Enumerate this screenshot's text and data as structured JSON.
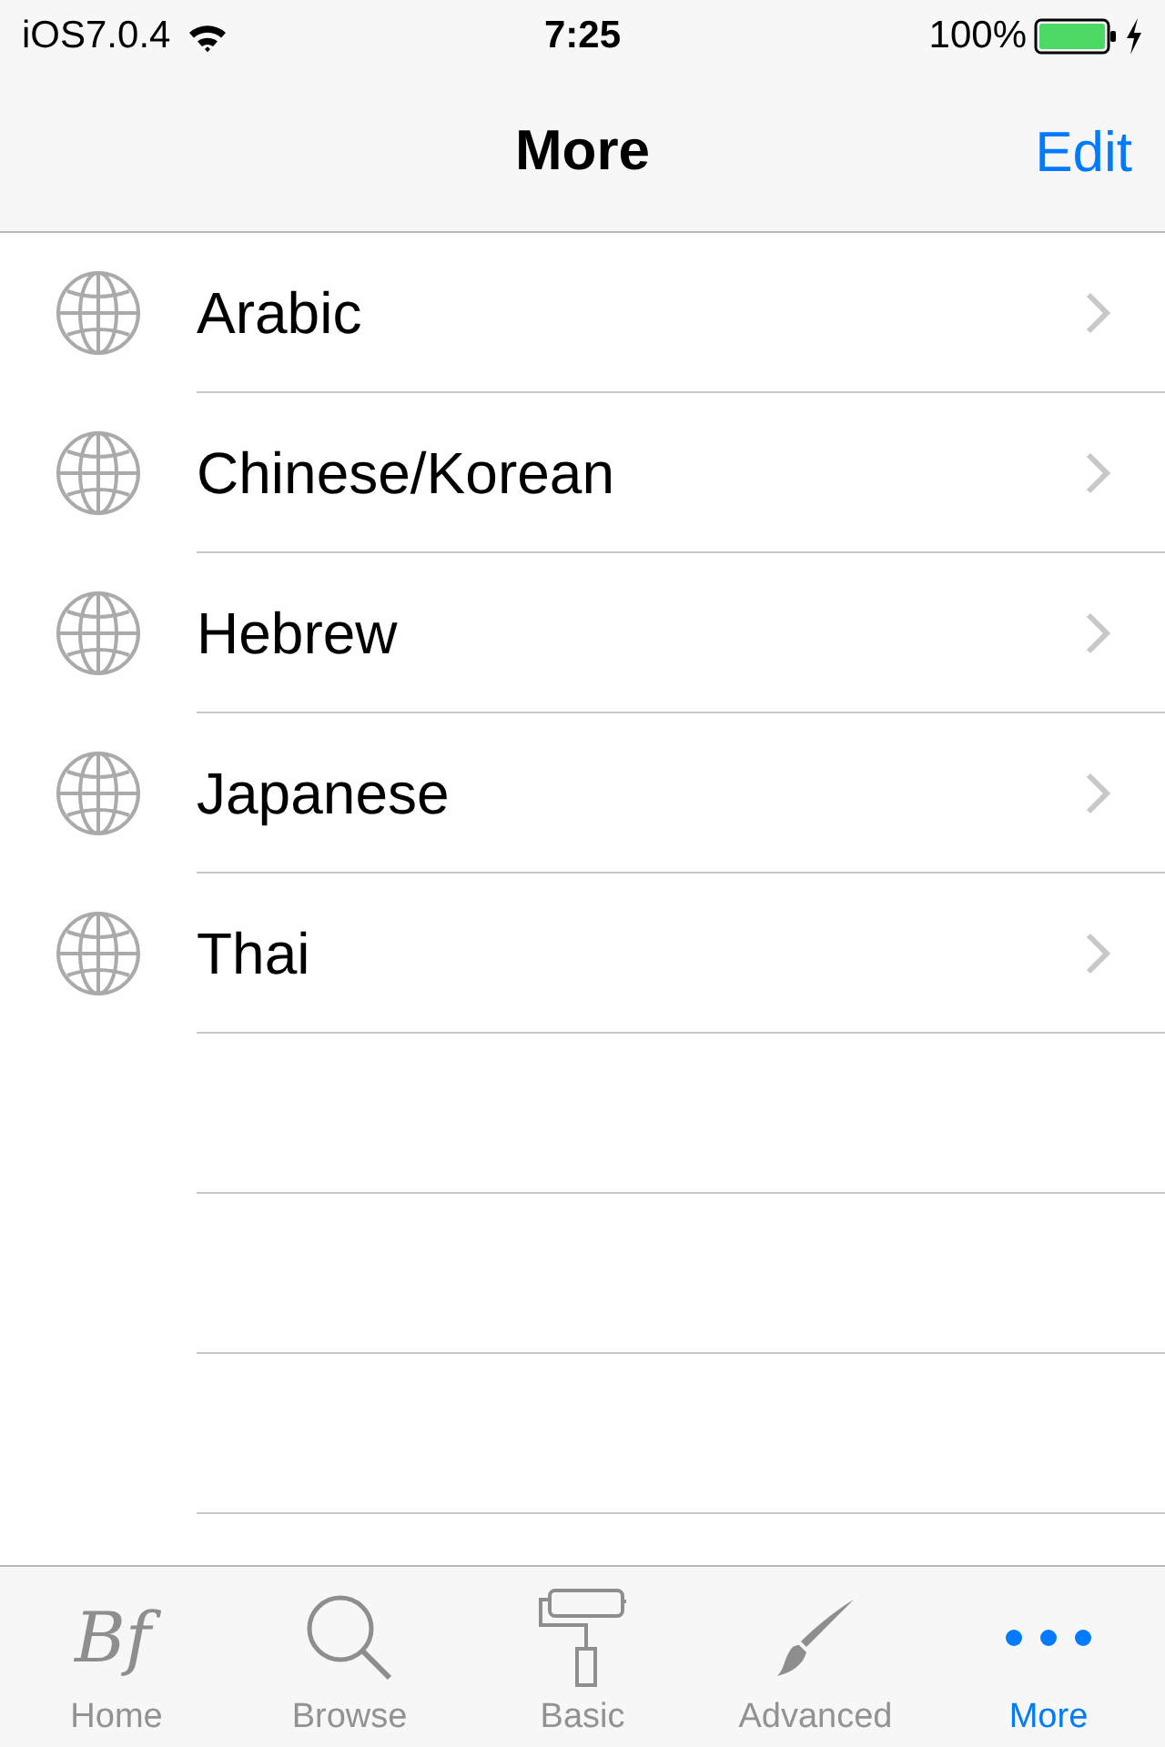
{
  "status_bar": {
    "carrier": "iOS7.0.4",
    "time": "7:25",
    "battery": "100%",
    "charging": true
  },
  "nav_bar": {
    "title": "More",
    "action": "Edit"
  },
  "list": [
    {
      "label": "Arabic"
    },
    {
      "label": "Chinese/Korean"
    },
    {
      "label": "Hebrew"
    },
    {
      "label": "Japanese"
    },
    {
      "label": "Thai"
    }
  ],
  "tab_bar": [
    {
      "kind": "logo",
      "logo_text": "Bf",
      "label": "Home",
      "selected": false
    },
    {
      "kind": "search",
      "label": "Browse",
      "selected": false
    },
    {
      "kind": "roller",
      "label": "Basic",
      "selected": false
    },
    {
      "kind": "brush",
      "label": "Advanced",
      "selected": false
    },
    {
      "kind": "more",
      "label": "More",
      "selected": true
    }
  ]
}
